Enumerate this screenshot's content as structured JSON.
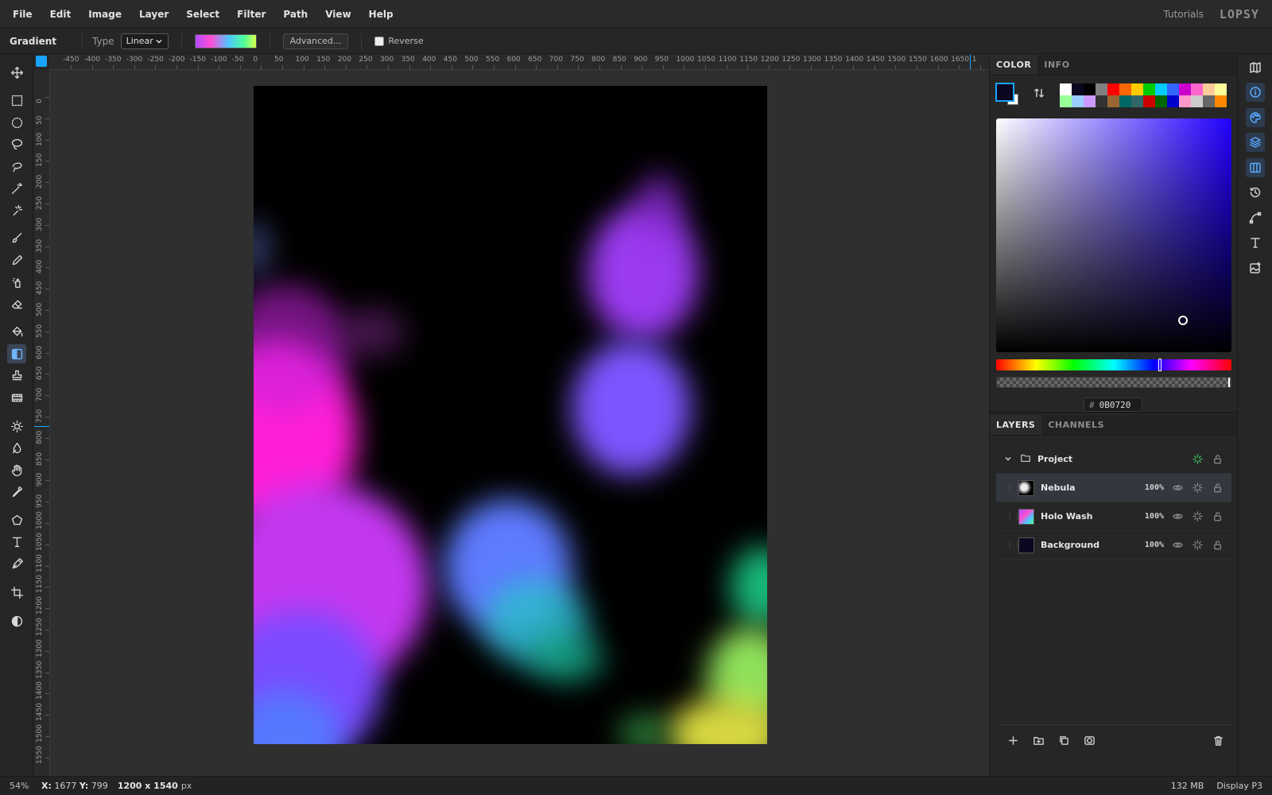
{
  "menu": [
    "File",
    "Edit",
    "Image",
    "Layer",
    "Select",
    "Filter",
    "Path",
    "View",
    "Help"
  ],
  "header": {
    "tutorials": "Tutorials",
    "logo": "LOPSY"
  },
  "options": {
    "tool_name": "Gradient",
    "type_label": "Type",
    "type_value": "Linear",
    "advanced_label": "Advanced...",
    "reverse_label": "Reverse",
    "reverse_checked": false
  },
  "tools": [
    "move-icon",
    "rect-select-icon",
    "ellipse-select-icon",
    "lasso-icon",
    "magnetic-lasso-icon",
    "magic-wand-icon",
    "quick-select-icon",
    "brush-icon",
    "pencil-icon",
    "spray-icon",
    "eraser-icon",
    "bucket-icon",
    "gradient-icon",
    "stamp-icon",
    "film-icon",
    "dodge-icon",
    "smudge-icon",
    "hand-icon",
    "eyedropper-icon",
    "polygon-icon",
    "text-icon",
    "pen-icon",
    "crop-icon",
    "contrast-icon"
  ],
  "ruler": {
    "top_labels": [
      "-450",
      "-400",
      "-350",
      "-300",
      "-250",
      "-200",
      "-150",
      "-100",
      "-50",
      "0",
      "50",
      "100",
      "150",
      "200",
      "250",
      "300",
      "350",
      "400",
      "450",
      "500",
      "550",
      "600",
      "650",
      "700",
      "750",
      "800",
      "850",
      "900",
      "950",
      "1000",
      "1050",
      "1100",
      "1150",
      "1200",
      "1250",
      "1300",
      "1350",
      "1400",
      "1450",
      "1500",
      "1550",
      "1600",
      "1650",
      "1"
    ],
    "left_labels": [
      "0",
      "50",
      "100",
      "150",
      "200",
      "250",
      "300",
      "350",
      "400",
      "450",
      "500",
      "550",
      "600",
      "650",
      "700",
      "750",
      "800",
      "850",
      "900",
      "950",
      "1000",
      "1050",
      "1100",
      "1150",
      "1200",
      "1250",
      "1300",
      "1350",
      "1400",
      "1450",
      "1500",
      "1550"
    ]
  },
  "color_panel": {
    "tabs": [
      "COLOR",
      "INFO"
    ],
    "active_tab": "COLOR",
    "foreground": "#0B0720",
    "background": "#FFFFFF",
    "hex": "0B0720",
    "hash": "#",
    "palette": [
      "#ffffff",
      "#0b0720",
      "#000000",
      "#808080",
      "#ff0000",
      "#ff6600",
      "#ffcc00",
      "#00cc00",
      "#00ccff",
      "#3366ff",
      "#cc00cc",
      "#ff66cc",
      "#ffcc99",
      "#ffff99",
      "#99ff99",
      "#99ccff",
      "#cc99ff",
      "#333333",
      "#996633",
      "#006666",
      "#336666",
      "#cc0000",
      "#006600",
      "#0000cc",
      "#ff99cc",
      "#cccccc",
      "#666666",
      "#ff8800"
    ]
  },
  "layers_panel": {
    "tabs": [
      "LAYERS",
      "CHANNELS"
    ],
    "active_tab": "LAYERS",
    "group": {
      "name": "Project"
    },
    "layers": [
      {
        "name": "Nebula",
        "opacity": "100%",
        "selected": true
      },
      {
        "name": "Holo Wash",
        "opacity": "100%",
        "selected": false
      },
      {
        "name": "Background",
        "opacity": "100%",
        "selected": false
      }
    ]
  },
  "status": {
    "zoom": "54%",
    "x_label": "X:",
    "x": "1677",
    "y_label": "Y:",
    "y": "799",
    "doc_size": "1200 x 1540",
    "doc_unit": "px",
    "memory": "132 MB",
    "profile": "Display P3"
  }
}
